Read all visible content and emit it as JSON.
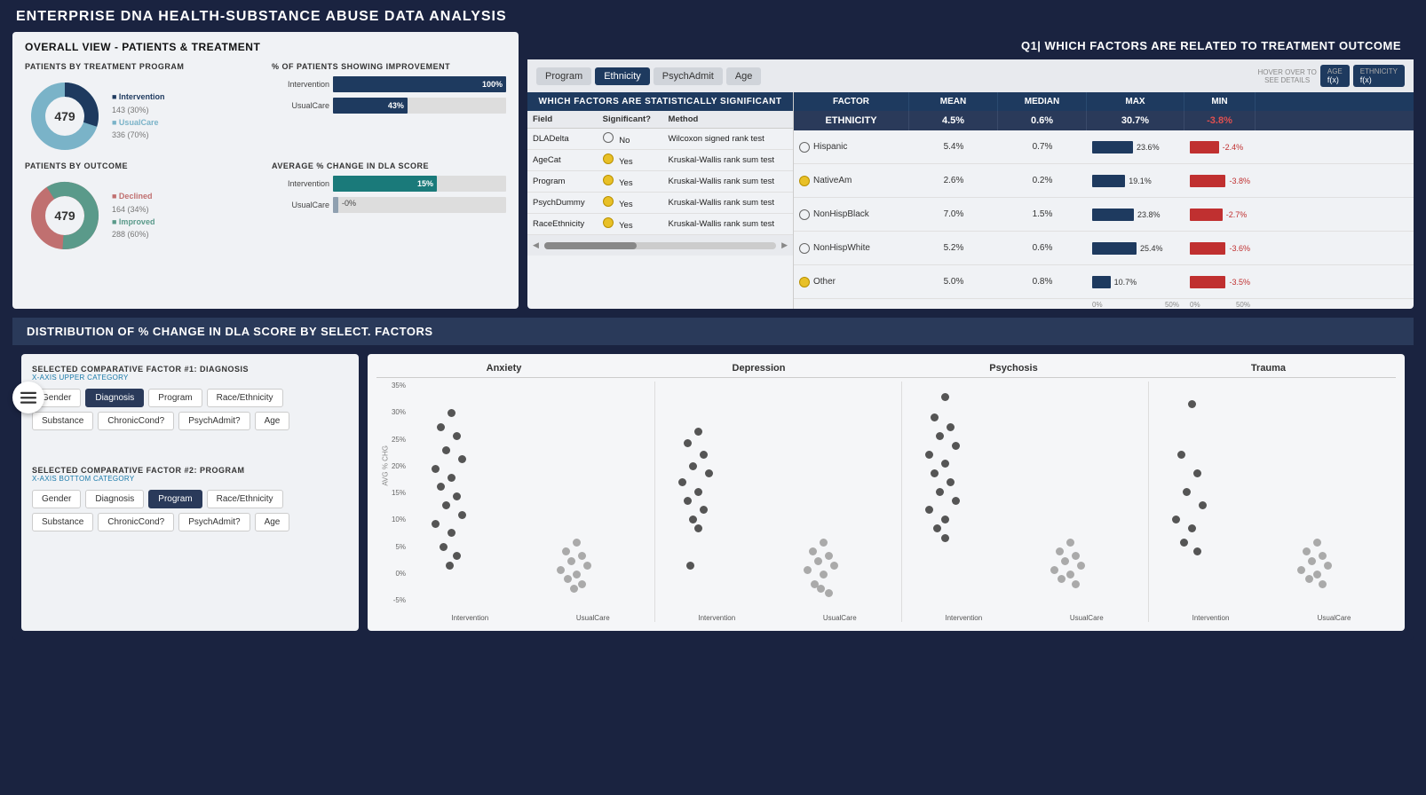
{
  "app": {
    "title": "ENTERPRISE DNA HEALTH-SUBSTANCE ABUSE DATA ANALYSIS"
  },
  "q1": {
    "header": "Q1| WHICH FACTORS ARE RELATED TO TREATMENT OUTCOME",
    "tabs": [
      "Program",
      "Ethnicity",
      "PsychAdmit",
      "Age"
    ],
    "active_tab": "Ethnicity",
    "hover_hint": "HOVER OVER TO SEE DETAILS",
    "mini_tabs": [
      "AGE f(x)",
      "ETHNICITY f(x)"
    ],
    "sig_table": {
      "title": "WHICH FACTORS ARE STATISTICALLY SIGNIFICANT",
      "headers": [
        "Field",
        "Significant?",
        "Method"
      ],
      "rows": [
        {
          "field": "DLADelta",
          "sig": "No",
          "dot": "empty",
          "method": "Wilcoxon signed rank test"
        },
        {
          "field": "AgeCat",
          "sig": "Yes",
          "dot": "yellow",
          "method": "Kruskal-Wallis rank sum test"
        },
        {
          "field": "Program",
          "sig": "Yes",
          "dot": "yellow",
          "method": "Kruskal-Wallis rank sum test"
        },
        {
          "field": "PsychDummy",
          "sig": "Yes",
          "dot": "yellow",
          "method": "Kruskal-Wallis rank sum test"
        },
        {
          "field": "RaceEthnicity",
          "sig": "Yes",
          "dot": "yellow",
          "method": "Kruskal-Wallis rank sum test"
        }
      ]
    },
    "stats": {
      "headers": [
        "FACTOR",
        "MEAN",
        "MEDIAN",
        "MAX",
        "MIN"
      ],
      "factor_row": [
        "ETHNICITY",
        "4.5%",
        "0.6%",
        "30.7%",
        "-3.8%"
      ],
      "ethnicity_rows": [
        {
          "name": "Hispanic",
          "dot": "empty",
          "mean": "5.4%",
          "median": "0.7%",
          "max_val": 23.6,
          "max_label": "23.6%",
          "min_val": -2.4,
          "min_label": "-2.4%"
        },
        {
          "name": "NativeAm",
          "dot": "yellow",
          "mean": "2.6%",
          "median": "0.2%",
          "max_val": 19.1,
          "max_label": "19.1%",
          "min_val": -3.8,
          "min_label": "-3.8%"
        },
        {
          "name": "NonHispBlack",
          "dot": "empty",
          "mean": "7.0%",
          "median": "1.5%",
          "max_val": 23.8,
          "max_label": "23.8%",
          "min_val": -2.7,
          "min_label": "-2.7%"
        },
        {
          "name": "NonHispWhite",
          "dot": "empty",
          "mean": "5.2%",
          "median": "0.6%",
          "max_val": 25.4,
          "max_label": "25.4%",
          "min_val": -3.6,
          "min_label": "-3.6%"
        },
        {
          "name": "Other",
          "dot": "yellow",
          "mean": "5.0%",
          "median": "0.8%",
          "max_val": 10.7,
          "max_label": "10.7%",
          "min_val": -3.5,
          "min_label": "-3.5%"
        }
      ],
      "x_axis": [
        "0%",
        "50%",
        "0%",
        "50%",
        "0%",
        "50%",
        "0%",
        "50%"
      ]
    }
  },
  "overall": {
    "title": "OVERALL VIEW - PATIENTS & TREATMENT",
    "treatment_program": {
      "title": "PATIENTS BY TREATMENT PROGRAM",
      "donut_value": "479",
      "segments": [
        {
          "label": "Intervention 143 (30%)",
          "color": "#1e3a5f",
          "pct": 30
        },
        {
          "label": "UsualCare 336 (70%)",
          "color": "#7ab3c8",
          "pct": 70
        }
      ],
      "bars_title": "% OF PATIENTS SHOWING IMPROVEMENT",
      "bars": [
        {
          "label": "Intervention",
          "value": 100,
          "display": "100%"
        },
        {
          "label": "UsualCare",
          "value": 43,
          "display": "43%"
        }
      ]
    },
    "outcome": {
      "title": "PATIENTS BY OUTCOME",
      "donut_value": "479",
      "segments": [
        {
          "label": "Declined 164 (34%)",
          "color": "#c07070",
          "pct": 34
        },
        {
          "label": "Improved 288 (60%)",
          "color": "#5a9a8a",
          "pct": 60
        }
      ],
      "bars_title": "AVERAGE % CHANGE IN DLA SCORE",
      "bars": [
        {
          "label": "Intervention",
          "value": 15,
          "display": "15%"
        },
        {
          "label": "UsualCare",
          "value": 0,
          "display": "-0%"
        }
      ]
    }
  },
  "distribution": {
    "title": "DISTRIBUTION OF % CHANGE IN DLA SCORE BY SELECT. FACTORS",
    "factor1": {
      "label": "SELECTED  COMPARATIVE FACTOR #1: DIAGNOSIS",
      "sublabel": "X-AXIS UPPER CATEGORY",
      "buttons": [
        "Gender",
        "Diagnosis",
        "Program",
        "Race/Ethnicity",
        "Substance",
        "ChronicCond?",
        "PsychAdmit?",
        "Age"
      ],
      "active": "Diagnosis"
    },
    "factor2": {
      "label": "SELECTED  COMPARATIVE FACTOR #2: PROGRAM",
      "sublabel": "X-AXIS BOTTOM CATEGORY",
      "buttons": [
        "Gender",
        "Diagnosis",
        "Program",
        "Race/Ethnicity",
        "Substance",
        "ChronicCond?",
        "PsychAdmit?",
        "Age"
      ],
      "active": "Program"
    },
    "chart": {
      "categories": [
        "Anxiety",
        "Depression",
        "Psychosis",
        "Trauma"
      ],
      "subcategories": [
        "Intervention",
        "UsualCare"
      ],
      "y_ticks": [
        "35%",
        "30%",
        "25%",
        "20%",
        "15%",
        "10%",
        "5%",
        "0%",
        "-5%"
      ],
      "y_label": "AVG % CHG"
    }
  }
}
